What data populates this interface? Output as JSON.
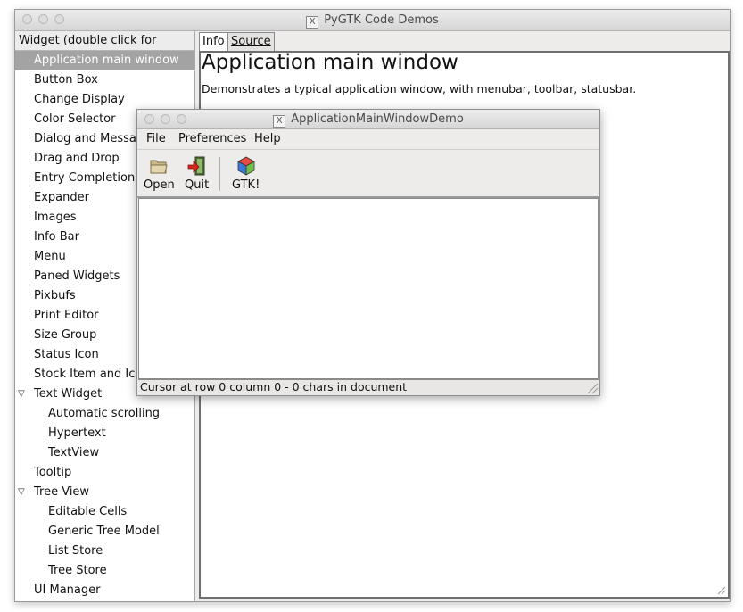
{
  "window": {
    "title": "PyGTK Code Demos"
  },
  "tree": {
    "header": "Widget (double click for demo)",
    "items": [
      {
        "label": "Application main window",
        "level": 1,
        "selected": true
      },
      {
        "label": "Button Box",
        "level": 1
      },
      {
        "label": "Change Display",
        "level": 1
      },
      {
        "label": "Color Selector",
        "level": 1
      },
      {
        "label": "Dialog and Message Boxes",
        "level": 1
      },
      {
        "label": "Drag and Drop",
        "level": 1
      },
      {
        "label": "Entry Completion",
        "level": 1
      },
      {
        "label": "Expander",
        "level": 1
      },
      {
        "label": "Images",
        "level": 1
      },
      {
        "label": "Info Bar",
        "level": 1
      },
      {
        "label": "Menu",
        "level": 1
      },
      {
        "label": "Paned Widgets",
        "level": 1
      },
      {
        "label": "Pixbufs",
        "level": 1
      },
      {
        "label": "Print Editor",
        "level": 1
      },
      {
        "label": "Size Group",
        "level": 1
      },
      {
        "label": "Status Icon",
        "level": 1
      },
      {
        "label": "Stock Item and Icon Browser",
        "level": 1
      },
      {
        "label": "Text Widget",
        "level": 1,
        "expanded": true
      },
      {
        "label": "Automatic scrolling",
        "level": 2
      },
      {
        "label": "Hypertext",
        "level": 2
      },
      {
        "label": "TextView",
        "level": 2
      },
      {
        "label": "Tooltip",
        "level": 1
      },
      {
        "label": "Tree View",
        "level": 1,
        "expanded": true
      },
      {
        "label": "Editable Cells",
        "level": 2
      },
      {
        "label": "Generic Tree Model",
        "level": 2
      },
      {
        "label": "List Store",
        "level": 2
      },
      {
        "label": "Tree Store",
        "level": 2
      },
      {
        "label": "UI Manager",
        "level": 1
      }
    ]
  },
  "notebook": {
    "tabs": [
      {
        "label": "Info",
        "active": true
      },
      {
        "label": "Source",
        "active": false
      }
    ],
    "info": {
      "title": "Application main window",
      "description": "Demonstrates a typical application window, with menubar, toolbar, statusbar."
    }
  },
  "demo": {
    "title": "ApplicationMainWindowDemo",
    "menus": [
      "File",
      "Preferences",
      "Help"
    ],
    "toolbar": [
      {
        "label": "Open",
        "icon": "folder-open-icon"
      },
      {
        "label": "Quit",
        "icon": "quit-exit-icon"
      },
      {
        "label": "GTK!",
        "icon": "gtk-logo-icon"
      }
    ],
    "statusbar": "Cursor at row 0 column 0 - 0 chars in document"
  },
  "colors": {
    "selection": "#a3a3a3",
    "window_bg": "#edeceb"
  }
}
